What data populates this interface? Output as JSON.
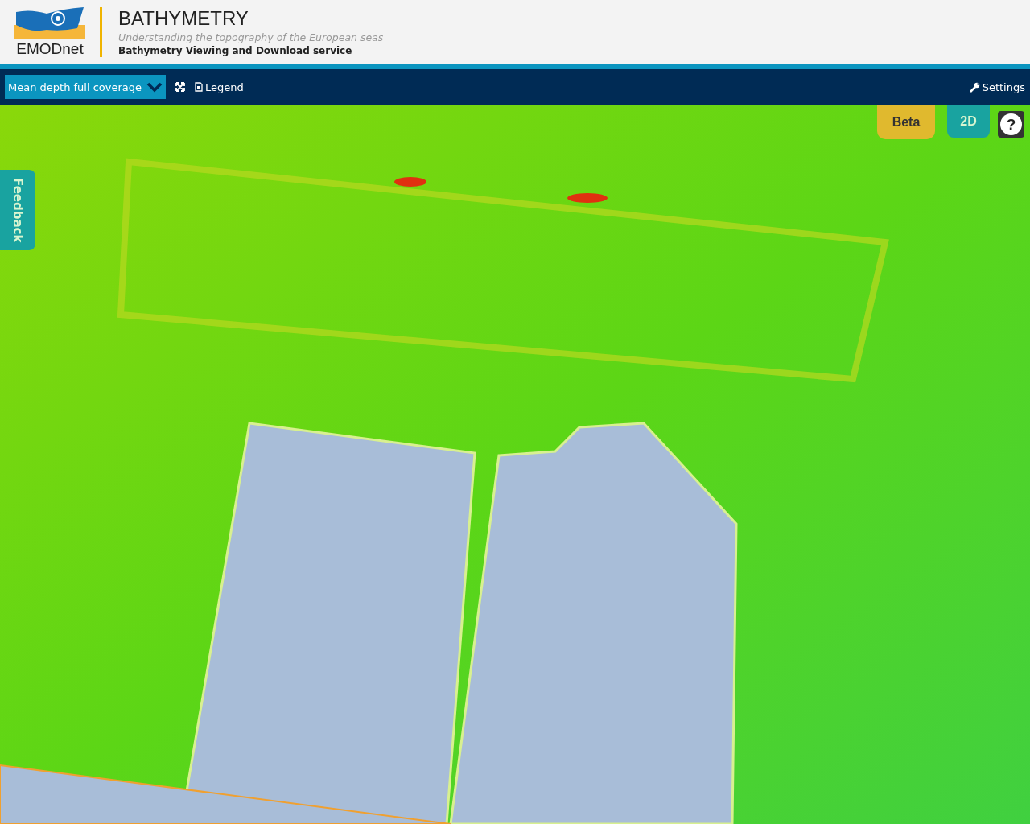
{
  "header": {
    "logo_text": "EMODnet",
    "title": "BATHYMETRY",
    "subtitle": "Understanding the topography of the European seas",
    "service": "Bathymetry Viewing and Download service"
  },
  "toolbar": {
    "layer_select": "Mean depth full coverage",
    "legend": "Legend",
    "settings": "Settings"
  },
  "map": {
    "beta": "Beta",
    "view_mode": "2D",
    "help": "?",
    "feedback": "Feedback"
  }
}
